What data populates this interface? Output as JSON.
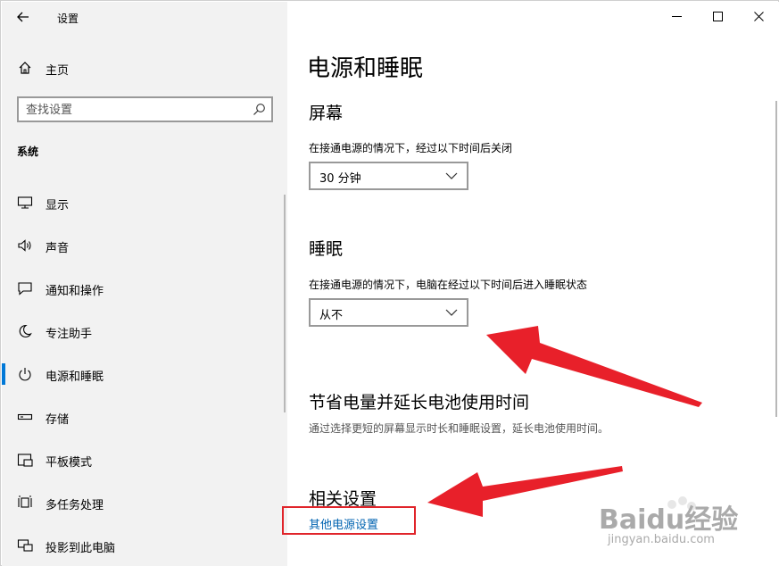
{
  "window": {
    "title": "设置"
  },
  "sidebar": {
    "home_label": "主页",
    "search_placeholder": "查找设置",
    "section_label": "系统",
    "items": [
      {
        "label": "显示",
        "icon": "monitor-icon"
      },
      {
        "label": "声音",
        "icon": "speaker-icon"
      },
      {
        "label": "通知和操作",
        "icon": "notification-icon"
      },
      {
        "label": "专注助手",
        "icon": "moon-icon"
      },
      {
        "label": "电源和睡眠",
        "icon": "power-icon",
        "active": true
      },
      {
        "label": "存储",
        "icon": "storage-icon"
      },
      {
        "label": "平板模式",
        "icon": "tablet-icon"
      },
      {
        "label": "多任务处理",
        "icon": "multitask-icon"
      },
      {
        "label": "投影到此电脑",
        "icon": "project-icon"
      }
    ]
  },
  "main": {
    "page_title": "电源和睡眠",
    "screen": {
      "heading": "屏幕",
      "description": "在接通电源的情况下，经过以下时间后关闭",
      "value": "30 分钟"
    },
    "sleep": {
      "heading": "睡眠",
      "description": "在接通电源的情况下，电脑在经过以下时间后进入睡眠状态",
      "value": "从不"
    },
    "battery": {
      "heading": "节省电量并延长电池使用时间",
      "description": "通过选择更短的屏幕显示时长和睡眠设置，延长电池使用时间。"
    },
    "related": {
      "heading": "相关设置",
      "link": "其他电源设置"
    }
  },
  "annotation_colors": {
    "arrow": "#e8202a",
    "highlight_box": "#e0242a",
    "accent": "#0078d7",
    "link": "#0063b1"
  },
  "watermark": {
    "brand": "Baidu经验",
    "url": "jingyan.baidu.com"
  }
}
